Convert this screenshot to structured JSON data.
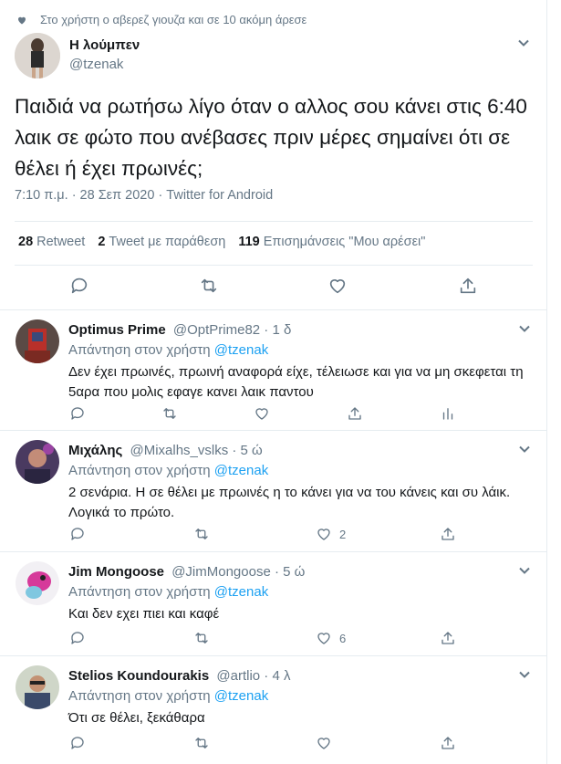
{
  "social_context": "Στο χρήστη ο αβερεζ γιουζα και σε 10 ακόμη άρεσε",
  "main_tweet": {
    "name": "Η λούμπεν",
    "handle": "@tzenak",
    "text": "Παιδιά να ρωτήσω λίγο όταν ο αλλος σου κάνει στις 6:40 λαικ σε φώτο που ανέβασες πριν μέρες σημαίνει ότι σε θέλει ή έχει πρωινές;",
    "time": "7:10 π.μ. · 28 Σεπ 2020 · Twitter for Android",
    "retweets_count": "28",
    "retweets_label": "Retweet",
    "quotes_count": "2",
    "quotes_label": "Tweet με παράθεση",
    "likes_count": "119",
    "likes_label": "Επισημάνσεις \"Μου αρέσει\""
  },
  "replies": [
    {
      "name": "Optimus Prime",
      "handle": "@OptPrime82 · 1 δ",
      "reply_to_prefix": "Απάντηση στον χρήστη ",
      "reply_to": "@tzenak",
      "text": "Δεν έχει πρωινές, πρωινή αναφορά είχε, τέλειωσε και για να μη σκεφεται τη 5αρα που μολις εφαγε κανει λαικ παντου",
      "likes": ""
    },
    {
      "name": "Μιχάλης",
      "handle": "@Mixalhs_vslks · 5 ώ",
      "reply_to_prefix": "Απάντηση στον χρήστη ",
      "reply_to": "@tzenak",
      "text": "2 σενάρια. Η σε θέλει με πρωινές η το κάνει για να του κάνεις και συ λάικ. Λογικά το πρώτο.",
      "likes": "2"
    },
    {
      "name": "Jim Mongoose",
      "handle": "@JimMongoose · 5 ώ",
      "reply_to_prefix": "Απάντηση στον χρήστη ",
      "reply_to": "@tzenak",
      "text": "Και δεν εχει πιει και καφέ",
      "likes": "6"
    },
    {
      "name": "Stelios Koundourakis",
      "handle": "@artlio · 4 λ",
      "reply_to_prefix": "Απάντηση στον χρήστη ",
      "reply_to": "@tzenak",
      "text": "Ότι σε θέλει, ξεκάθαρα",
      "likes": ""
    }
  ],
  "colors": {
    "accent": "#1da1f2",
    "muted": "#657786",
    "text": "#14171a",
    "border": "#e6ecf0"
  }
}
